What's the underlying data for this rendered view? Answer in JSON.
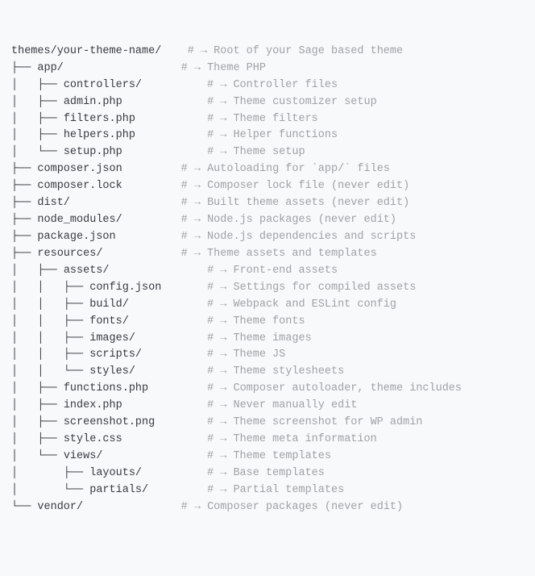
{
  "rows": [
    {
      "tree": "",
      "name": "themes/your-theme-name/",
      "pad": 4,
      "hash": "#",
      "arrow": "→",
      "desc": "Root of your Sage based theme",
      "code": ""
    },
    {
      "tree": "├── ",
      "name": "app/",
      "pad": 18,
      "hash": "#",
      "arrow": "→",
      "desc": "Theme PHP",
      "code": ""
    },
    {
      "tree": "│   ├── ",
      "name": "controllers/",
      "pad": 10,
      "hash": "#",
      "arrow": "→",
      "desc": "Controller files",
      "code": ""
    },
    {
      "tree": "│   ├── ",
      "name": "admin.php",
      "pad": 13,
      "hash": "#",
      "arrow": "→",
      "desc": "Theme customizer setup",
      "code": ""
    },
    {
      "tree": "│   ├── ",
      "name": "filters.php",
      "pad": 11,
      "hash": "#",
      "arrow": "→",
      "desc": "Theme filters",
      "code": ""
    },
    {
      "tree": "│   ├── ",
      "name": "helpers.php",
      "pad": 11,
      "hash": "#",
      "arrow": "→",
      "desc": "Helper functions",
      "code": ""
    },
    {
      "tree": "│   └── ",
      "name": "setup.php",
      "pad": 13,
      "hash": "#",
      "arrow": "→",
      "desc": "Theme setup",
      "code": ""
    },
    {
      "tree": "├── ",
      "name": "composer.json",
      "pad": 9,
      "hash": "#",
      "arrow": "→",
      "desc": "Autoloading for ",
      "code": "`app/`",
      "desc2": " files"
    },
    {
      "tree": "├── ",
      "name": "composer.lock",
      "pad": 9,
      "hash": "#",
      "arrow": "→",
      "desc": "Composer lock file (never edit)",
      "code": ""
    },
    {
      "tree": "├── ",
      "name": "dist/",
      "pad": 17,
      "hash": "#",
      "arrow": "→",
      "desc": "Built theme assets (never edit)",
      "code": ""
    },
    {
      "tree": "├── ",
      "name": "node_modules/",
      "pad": 9,
      "hash": "#",
      "arrow": "→",
      "desc": "Node.js packages (never edit)",
      "code": ""
    },
    {
      "tree": "├── ",
      "name": "package.json",
      "pad": 10,
      "hash": "#",
      "arrow": "→",
      "desc": "Node.js dependencies and scripts",
      "code": ""
    },
    {
      "tree": "├── ",
      "name": "resources/",
      "pad": 12,
      "hash": "#",
      "arrow": "→",
      "desc": "Theme assets and templates",
      "code": ""
    },
    {
      "tree": "│   ├── ",
      "name": "assets/",
      "pad": 15,
      "hash": "#",
      "arrow": "→",
      "desc": "Front-end assets",
      "code": ""
    },
    {
      "tree": "│   │   ├── ",
      "name": "config.json",
      "pad": 7,
      "hash": "#",
      "arrow": "→",
      "desc": "Settings for compiled assets",
      "code": ""
    },
    {
      "tree": "│   │   ├── ",
      "name": "build/",
      "pad": 12,
      "hash": "#",
      "arrow": "→",
      "desc": "Webpack and ESLint config",
      "code": ""
    },
    {
      "tree": "│   │   ├── ",
      "name": "fonts/",
      "pad": 12,
      "hash": "#",
      "arrow": "→",
      "desc": "Theme fonts",
      "code": ""
    },
    {
      "tree": "│   │   ├── ",
      "name": "images/",
      "pad": 11,
      "hash": "#",
      "arrow": "→",
      "desc": "Theme images",
      "code": ""
    },
    {
      "tree": "│   │   ├── ",
      "name": "scripts/",
      "pad": 10,
      "hash": "#",
      "arrow": "→",
      "desc": "Theme JS",
      "code": ""
    },
    {
      "tree": "│   │   └── ",
      "name": "styles/",
      "pad": 11,
      "hash": "#",
      "arrow": "→",
      "desc": "Theme stylesheets",
      "code": ""
    },
    {
      "tree": "│   ├── ",
      "name": "functions.php",
      "pad": 9,
      "hash": "#",
      "arrow": "→",
      "desc": "Composer autoloader, theme includes",
      "code": ""
    },
    {
      "tree": "│   ├── ",
      "name": "index.php",
      "pad": 13,
      "hash": "#",
      "arrow": "→",
      "desc": "Never manually edit",
      "code": ""
    },
    {
      "tree": "│   ├── ",
      "name": "screenshot.png",
      "pad": 8,
      "hash": "#",
      "arrow": "→",
      "desc": "Theme screenshot for WP admin",
      "code": ""
    },
    {
      "tree": "│   ├── ",
      "name": "style.css",
      "pad": 13,
      "hash": "#",
      "arrow": "→",
      "desc": "Theme meta information",
      "code": ""
    },
    {
      "tree": "│   └── ",
      "name": "views/",
      "pad": 16,
      "hash": "#",
      "arrow": "→",
      "desc": "Theme templates",
      "code": ""
    },
    {
      "tree": "│       ├── ",
      "name": "layouts/",
      "pad": 10,
      "hash": "#",
      "arrow": "→",
      "desc": "Base templates",
      "code": ""
    },
    {
      "tree": "│       └── ",
      "name": "partials/",
      "pad": 9,
      "hash": "#",
      "arrow": "→",
      "desc": "Partial templates",
      "code": ""
    },
    {
      "tree": "└── ",
      "name": "vendor/",
      "pad": 15,
      "hash": "#",
      "arrow": "→",
      "desc": "Composer packages (never edit)",
      "code": ""
    }
  ]
}
